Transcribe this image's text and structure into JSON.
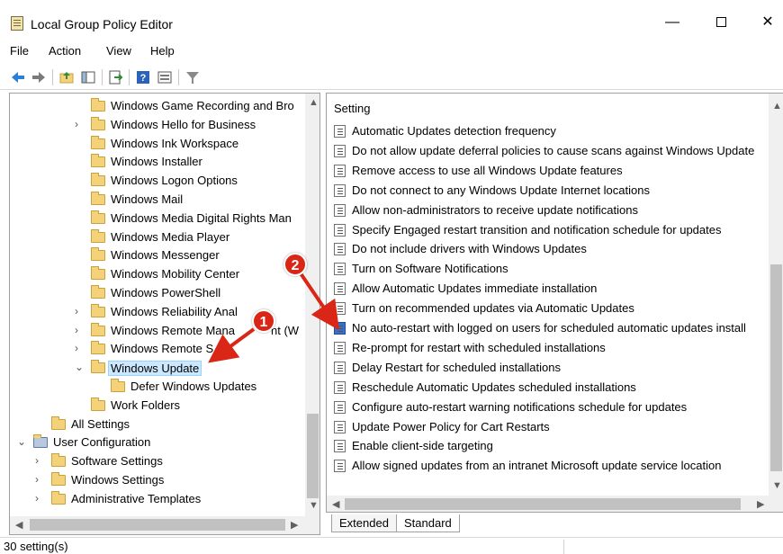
{
  "window": {
    "title": "Local Group Policy Editor",
    "minimize": "—",
    "close": "✕"
  },
  "menu": [
    "File",
    "Action",
    "View",
    "Help"
  ],
  "tree": {
    "items": [
      {
        "label": "Windows Game Recording and Bro",
        "indent": 2,
        "expander": ""
      },
      {
        "label": "Windows Hello for Business",
        "indent": 2,
        "expander": "›"
      },
      {
        "label": "Windows Ink Workspace",
        "indent": 2,
        "expander": ""
      },
      {
        "label": "Windows Installer",
        "indent": 2,
        "expander": ""
      },
      {
        "label": "Windows Logon Options",
        "indent": 2,
        "expander": ""
      },
      {
        "label": "Windows Mail",
        "indent": 2,
        "expander": ""
      },
      {
        "label": "Windows Media Digital Rights Man",
        "indent": 2,
        "expander": ""
      },
      {
        "label": "Windows Media Player",
        "indent": 2,
        "expander": ""
      },
      {
        "label": "Windows Messenger",
        "indent": 2,
        "expander": ""
      },
      {
        "label": "Windows Mobility Center",
        "indent": 2,
        "expander": ""
      },
      {
        "label": "Windows PowerShell",
        "indent": 2,
        "expander": ""
      },
      {
        "label": "Windows Reliability Anal",
        "indent": 2,
        "expander": "›"
      },
      {
        "label": "Windows Remote Mana",
        "indent": 2,
        "expander": "›",
        "suffix": "nt (W"
      },
      {
        "label": "Windows Remote S",
        "indent": 2,
        "expander": "›"
      },
      {
        "label": "Windows Update",
        "indent": 2,
        "expander": "⌄",
        "selected": true
      },
      {
        "label": "Defer Windows Updates",
        "indent": 3,
        "expander": ""
      },
      {
        "label": "Work Folders",
        "indent": 2,
        "expander": ""
      },
      {
        "label": "All Settings",
        "indent": 1,
        "expander": ""
      },
      {
        "label": "User Configuration",
        "indent": 0,
        "expander": "⌄"
      },
      {
        "label": "Software Settings",
        "indent": 1,
        "expander": "›"
      },
      {
        "label": "Windows Settings",
        "indent": 1,
        "expander": "›"
      },
      {
        "label": "Administrative Templates",
        "indent": 1,
        "expander": "›"
      }
    ]
  },
  "settings": {
    "column_header": "Setting",
    "rows": [
      "Automatic Updates detection frequency",
      "Do not allow update deferral policies to cause scans against Windows Update",
      "Remove access to use all Windows Update features",
      "Do not connect to any Windows Update Internet locations",
      "Allow non-administrators to receive update notifications",
      "Specify Engaged restart transition and notification schedule for updates",
      "Do not include drivers with Windows Updates",
      "Turn on Software Notifications",
      "Allow Automatic Updates immediate installation",
      "Turn on recommended updates via Automatic Updates",
      "No auto-restart with logged on users for scheduled automatic updates install",
      "Re-prompt for restart with scheduled installations",
      "Delay Restart for scheduled installations",
      "Reschedule Automatic Updates scheduled installations",
      "Configure auto-restart warning notifications schedule for updates",
      "Update Power Policy for Cart Restarts",
      "Enable client-side targeting",
      "Allow signed updates from an intranet Microsoft update service location"
    ],
    "selected_index": 10
  },
  "tabs": [
    "Extended",
    "Standard"
  ],
  "active_tab": "Standard",
  "status": "30 setting(s)",
  "callouts": [
    "1",
    "2"
  ],
  "colors": {
    "callout": "#d92616",
    "selection": "#cce8ff",
    "folder": "#f4d27a"
  }
}
